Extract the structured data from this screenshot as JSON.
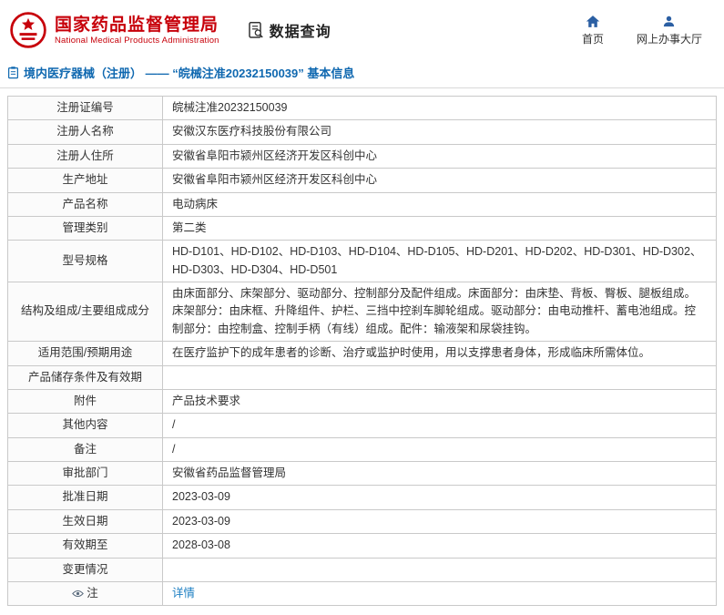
{
  "header": {
    "org_name_cn": "国家药品监督管理局",
    "org_name_en": "National Medical Products Administration",
    "section_label": "数据查询",
    "nav_home": "首页",
    "nav_hall": "网上办事大厅"
  },
  "page_title": "境内医疗器械（注册） —— “皖械注准20232150039” 基本信息",
  "colors": {
    "brand_red": "#c7000a",
    "title_blue": "#0f68b0",
    "link_blue": "#1b7ec2",
    "icon_blue": "#2b5fa3"
  },
  "table": {
    "rows": [
      {
        "label": "注册证编号",
        "value": "皖械注准20232150039"
      },
      {
        "label": "注册人名称",
        "value": "安徽汉东医疗科技股份有限公司"
      },
      {
        "label": "注册人住所",
        "value": "安徽省阜阳市颍州区经济开发区科创中心"
      },
      {
        "label": "生产地址",
        "value": "安徽省阜阳市颍州区经济开发区科创中心"
      },
      {
        "label": "产品名称",
        "value": "电动病床"
      },
      {
        "label": "管理类别",
        "value": "第二类"
      },
      {
        "label": "型号规格",
        "value": "HD-D101、HD-D102、HD-D103、HD-D104、HD-D105、HD-D201、HD-D202、HD-D301、HD-D302、HD-D303、HD-D304、HD-D501"
      },
      {
        "label": "结构及组成/主要组成成分",
        "value": "由床面部分、床架部分、驱动部分、控制部分及配件组成。床面部分：由床垫、背板、臀板、腿板组成。床架部分：由床框、升降组件、护栏、三挡中控刹车脚轮组成。驱动部分：由电动推杆、蓄电池组成。控制部分：由控制盒、控制手柄（有线）组成。配件：输液架和尿袋挂钩。"
      },
      {
        "label": "适用范围/预期用途",
        "value": "在医疗监护下的成年患者的诊断、治疗或监护时使用，用以支撑患者身体，形成临床所需体位。"
      },
      {
        "label": "产品储存条件及有效期",
        "value": ""
      },
      {
        "label": "附件",
        "value": "产品技术要求"
      },
      {
        "label": "其他内容",
        "value": "/"
      },
      {
        "label": "备注",
        "value": "/"
      },
      {
        "label": "审批部门",
        "value": "安徽省药品监督管理局"
      },
      {
        "label": "批准日期",
        "value": "2023-03-09"
      },
      {
        "label": "生效日期",
        "value": "2023-03-09"
      },
      {
        "label": "有效期至",
        "value": "2028-03-08"
      },
      {
        "label": "变更情况",
        "value": ""
      },
      {
        "label": "注",
        "value": "详情",
        "link": true,
        "icon": "eye-icon"
      }
    ]
  }
}
